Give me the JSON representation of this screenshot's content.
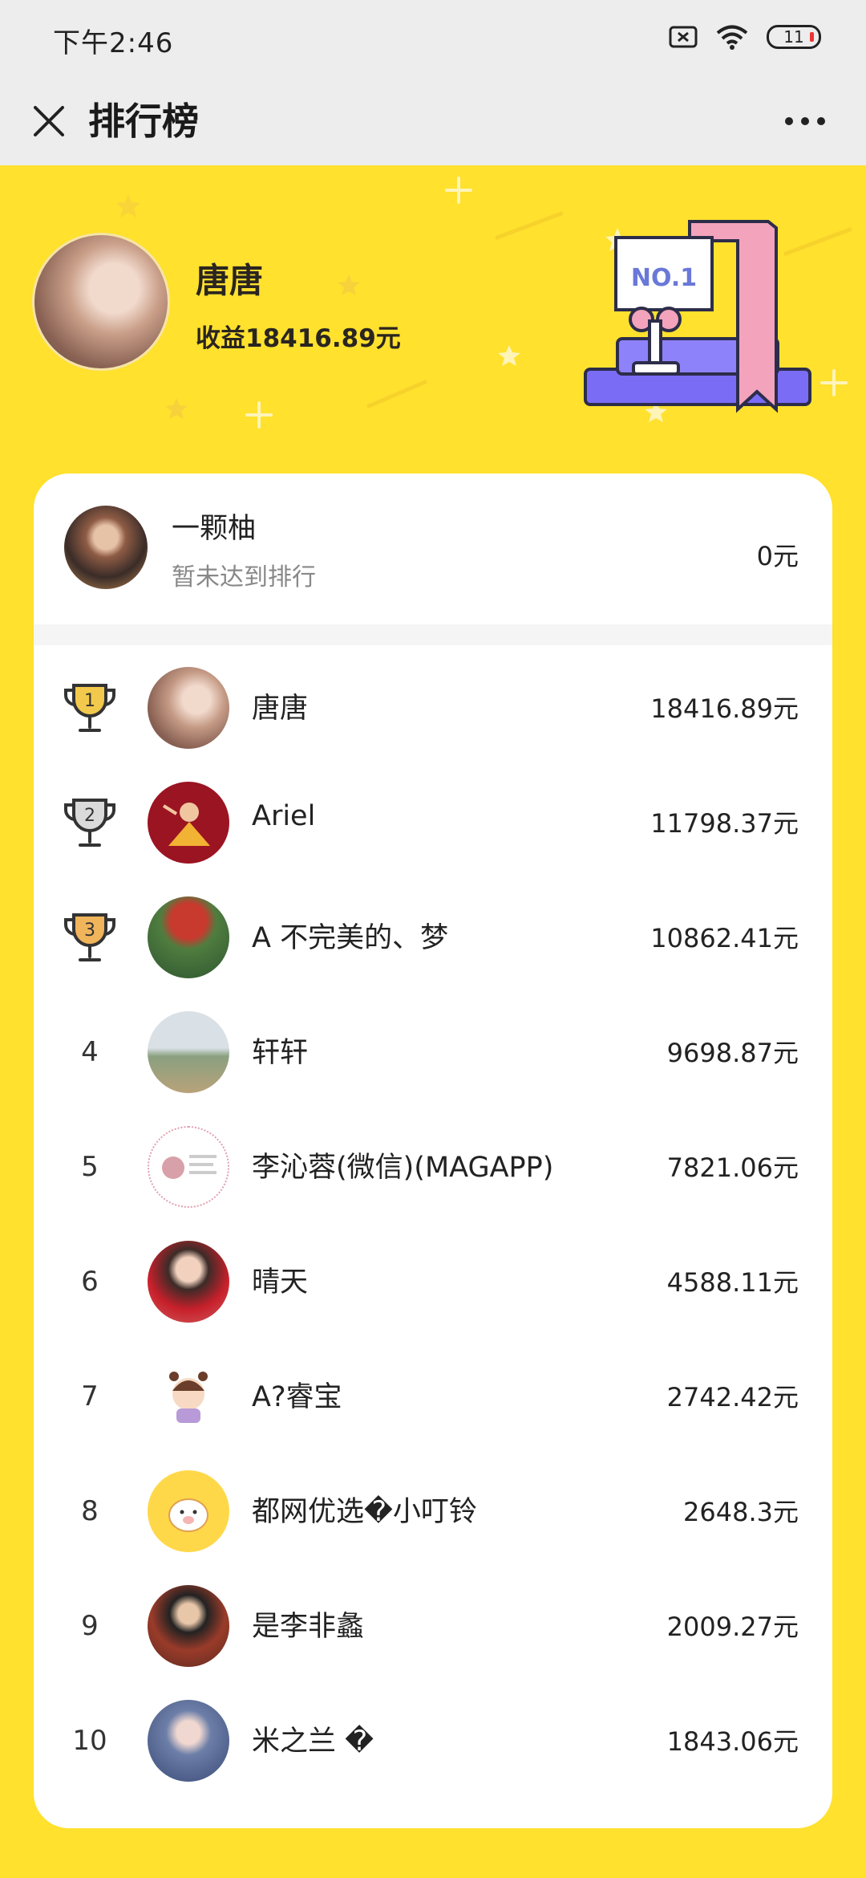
{
  "status_bar": {
    "time": "下午2:46",
    "battery": "11"
  },
  "nav": {
    "title": "排行榜"
  },
  "hero": {
    "name": "唐唐",
    "earnings": "收益18416.89元",
    "badge": "NO.1"
  },
  "me": {
    "name": "一颗柚",
    "status": "暂未达到排行",
    "amount": "0元"
  },
  "ranking": [
    {
      "rank": "1",
      "name": "唐唐",
      "amount": "18416.89元"
    },
    {
      "rank": "2",
      "name": "Ariel",
      "amount": "11798.37元"
    },
    {
      "rank": "3",
      "name": "A 不完美的、梦",
      "amount": "10862.41元"
    },
    {
      "rank": "4",
      "name": "轩轩",
      "amount": "9698.87元"
    },
    {
      "rank": "5",
      "name": "李沁蓉(微信)(MAGAPP)",
      "amount": "7821.06元"
    },
    {
      "rank": "6",
      "name": "晴天",
      "amount": "4588.11元"
    },
    {
      "rank": "7",
      "name": "A?睿宝",
      "amount": "2742.42元"
    },
    {
      "rank": "8",
      "name": "都网优选�小叮铃",
      "amount": "2648.3元"
    },
    {
      "rank": "9",
      "name": "是李非蠡",
      "amount": "2009.27元"
    },
    {
      "rank": "10",
      "name": "米之兰 �",
      "amount": "1843.06元"
    }
  ],
  "colors": {
    "background": "#FFE12E",
    "gold": "#F2C94C",
    "silver": "#DADADA",
    "bronze": "#F0B45A"
  }
}
